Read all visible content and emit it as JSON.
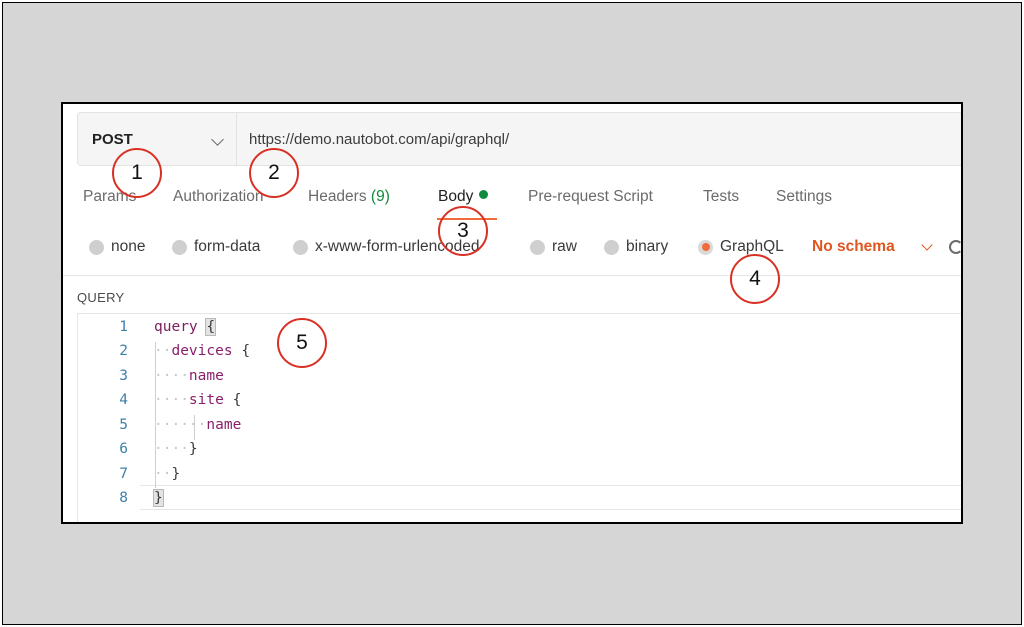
{
  "request": {
    "method": "POST",
    "url": "https://demo.nautobot.com/api/graphql/"
  },
  "tabs": [
    {
      "label": "Params"
    },
    {
      "label": "Authorization"
    },
    {
      "label": "Headers",
      "count": "(9)"
    },
    {
      "label": "Body"
    },
    {
      "label": "Pre-request Script"
    },
    {
      "label": "Tests"
    },
    {
      "label": "Settings"
    }
  ],
  "body_types": [
    {
      "label": "none"
    },
    {
      "label": "form-data"
    },
    {
      "label": "x-www-form-urlencoded"
    },
    {
      "label": "raw"
    },
    {
      "label": "binary"
    },
    {
      "label": "GraphQL",
      "selected": true
    }
  ],
  "schema_select": "No schema",
  "query_section": {
    "label": "QUERY",
    "line_numbers": [
      "1",
      "2",
      "3",
      "4",
      "5",
      "6",
      "7",
      "8"
    ],
    "code": {
      "l1_kw": "query",
      "l1_brace": "{",
      "l2_field": "devices",
      "l2_brace": "{",
      "l3_field": "name",
      "l4_field": "site",
      "l4_brace": "{",
      "l5_field": "name",
      "l6_brace": "}",
      "l7_brace": "}",
      "l8_brace": "}"
    }
  },
  "callouts": [
    "1",
    "2",
    "3",
    "4",
    "5"
  ],
  "colors": {
    "accent": "#f26b3a",
    "schema": "#e0561f",
    "headers_count": "#0f8a3e",
    "callout_ring": "#d93025",
    "line_number": "#3f7fa8",
    "keyword": "#7a1e5c"
  }
}
